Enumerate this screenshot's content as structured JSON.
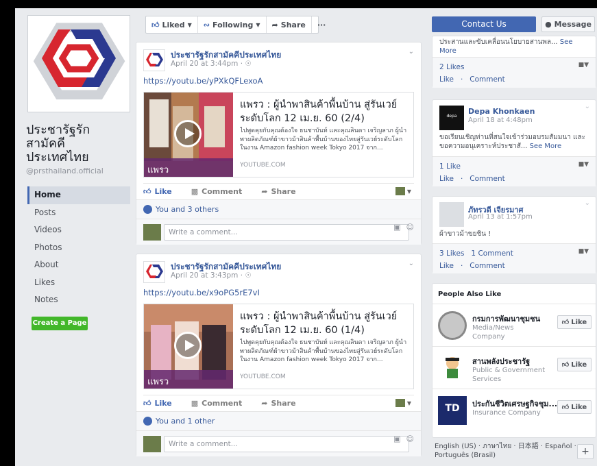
{
  "page": {
    "name": "ประชารัฐรัก สามัคคี ประเทศไทย",
    "name_line1": "ประชารัฐรัก",
    "name_line2": "สามัคคี",
    "name_line3": "ประเทศไทย",
    "handle": "@prsthailand.official"
  },
  "nav": {
    "items": [
      {
        "label": "Home",
        "active": true
      },
      {
        "label": "Posts"
      },
      {
        "label": "Videos"
      },
      {
        "label": "Photos"
      },
      {
        "label": "About"
      },
      {
        "label": "Likes"
      },
      {
        "label": "Notes"
      }
    ],
    "create_page": "Create a Page"
  },
  "action_bar": {
    "liked": "Liked",
    "following": "Following",
    "share": "Share",
    "more": "···"
  },
  "posts": [
    {
      "author": "ประชารัฐรักสามัคคีประเทศไทย",
      "time": "April 20 at 3:44pm · ",
      "link": "https://youtu.be/yPXkQFLexoA",
      "card_title": "แพรว : ผู้นำพาสินค้าพื้นบ้าน สู่รันเวย์ระดับโลก 12 เม.ย. 60 (2/4)",
      "card_desc": "ไปพูดคุยกับคุณต้องใจ ธนชาบันท์ และคุณลินดา เจริญลาภ ผู้นำพาผลิตภัณฑ์ผ้าขาวม้าสินค้าพื้นบ้านของไทยสู่รันเวย์ระดับโลก ในงาน Amazon fashion week Tokyo 2017 จาก...",
      "card_src": "YOUTUBE.COM",
      "thumb_label": "แพรว",
      "likes_text": "You and 3 others"
    },
    {
      "author": "ประชารัฐรักสามัคคีประเทศไทย",
      "time": "April 20 at 3:43pm · ",
      "link": "https://youtu.be/x9oPG5rE7vI",
      "card_title": "แพรว : ผู้นำพาสินค้าพื้นบ้าน สู่รันเวย์ระดับโลก 12 เม.ย. 60 (1/4)",
      "card_desc": "ไปพูดคุยกับคุณต้องใจ ธนชาบันท์ และคุณลินดา เจริญลาภ ผู้นำพาผลิตภัณฑ์ผ้าขาวม้าสินค้าพื้นบ้านของไทยสู่รันเวย์ระดับโลก ในงาน Amazon fashion week Tokyo 2017 จาก...",
      "card_src": "YOUTUBE.COM",
      "thumb_label": "แพรว",
      "likes_text": "You and 1 other"
    }
  ],
  "post_actions": {
    "like": "Like",
    "comment": "Comment",
    "share": "Share",
    "write_comment": "Write a comment..."
  },
  "right": {
    "contact": "Contact Us",
    "message": "Message",
    "cards": [
      {
        "text": "ประสานและขับเคลื่อนนโยบายสานพล...",
        "more": "See More",
        "likes": "2 Likes",
        "like": "Like",
        "comment": "Comment"
      },
      {
        "name": "Depa Khonkaen",
        "time": "April 18 at 4:48pm",
        "text": "ขอเรียนเชิญท่านที่สนใจเข้าร่วมอบรมสัมมนา และขอความอนุเคราะห์ประชาสั...",
        "more": "See More",
        "likes": "1 Like",
        "like": "Like",
        "comment": "Comment"
      },
      {
        "name": "ภัทรวดี เจียรมาศ",
        "time": "April 13 at 1:57pm",
        "text": "ผ้าขาวม้าขยชิน !",
        "likes": "3 Likes",
        "comments": "1 Comment",
        "like": "Like",
        "comment": "Comment"
      }
    ],
    "people_also_like": {
      "title": "People Also Like",
      "items": [
        {
          "name": "กรมการพัฒนาชุมชน",
          "category": "Media/News Company",
          "like": "Like"
        },
        {
          "name": "สานพลังประชารัฐ",
          "category": "Public & Government Services",
          "like": "Like"
        },
        {
          "name": "ประกันชีวิตเศรษฐกิจชุม...",
          "category": "Insurance Company",
          "like": "Like"
        }
      ]
    },
    "languages": "English (US) · ภาษาไทย · 日本語 · Español · Português (Brasil)"
  },
  "colors": {
    "brand_blue": "#4267b2",
    "link_blue": "#365899",
    "create_green": "#42b72a",
    "background": "#e9ebee"
  }
}
